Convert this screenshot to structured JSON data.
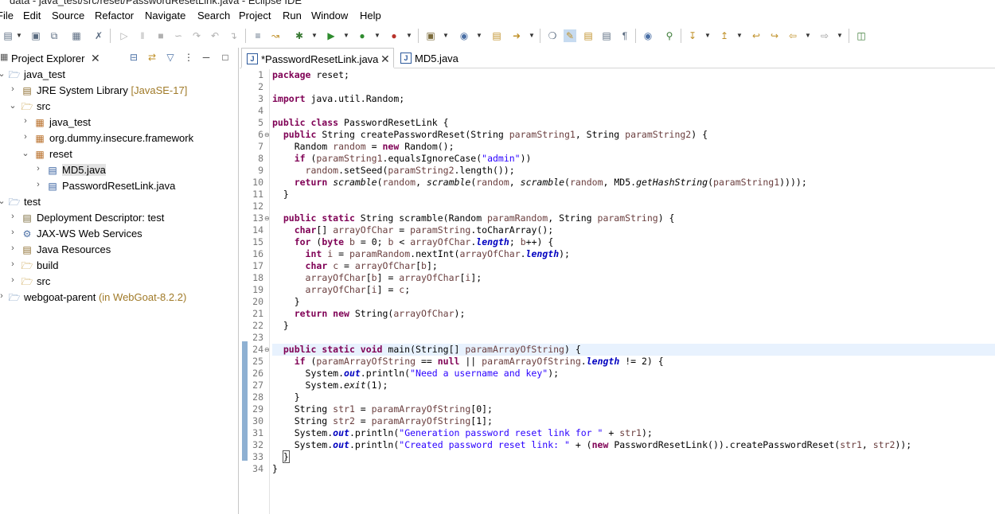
{
  "window": {
    "title": "data - java_test/src/reset/PasswordResetLink.java - Eclipse IDE"
  },
  "menu": [
    "File",
    "Edit",
    "Source",
    "Refactor",
    "Navigate",
    "Search",
    "Project",
    "Run",
    "Window",
    "Help"
  ],
  "explorer": {
    "tab_label": "Project Explorer",
    "tree": [
      {
        "label": "java_test",
        "decoration": ""
      },
      {
        "label": "JRE System Library",
        "decoration": "[JavaSE-17]"
      },
      {
        "label": "src",
        "decoration": ""
      },
      {
        "label": "java_test",
        "decoration": ""
      },
      {
        "label": "org.dummy.insecure.framework",
        "decoration": ""
      },
      {
        "label": "reset",
        "decoration": ""
      },
      {
        "label": "MD5.java",
        "decoration": ""
      },
      {
        "label": "PasswordResetLink.java",
        "decoration": ""
      },
      {
        "label": "test",
        "decoration": ""
      },
      {
        "label": "Deployment Descriptor: test",
        "decoration": ""
      },
      {
        "label": "JAX-WS Web Services",
        "decoration": ""
      },
      {
        "label": "Java Resources",
        "decoration": ""
      },
      {
        "label": "build",
        "decoration": ""
      },
      {
        "label": "src",
        "decoration": ""
      },
      {
        "label": "webgoat-parent",
        "decoration": "(in WebGoat-8.2.2)"
      }
    ]
  },
  "editor": {
    "tabs": [
      {
        "label": "*PasswordResetLink.java",
        "active": true
      },
      {
        "label": "MD5.java",
        "active": false
      }
    ],
    "line_numbers": [
      "1",
      "2",
      "3",
      "4",
      "5",
      "6",
      "7",
      "8",
      "9",
      "10",
      "11",
      "12",
      "13",
      "14",
      "15",
      "16",
      "17",
      "18",
      "19",
      "20",
      "21",
      "22",
      "23",
      "24",
      "25",
      "26",
      "27",
      "28",
      "29",
      "30",
      "31",
      "32",
      "33",
      "34"
    ],
    "lines": [
      [
        [
          "k",
          "package"
        ],
        [
          "p",
          " reset;"
        ]
      ],
      [],
      [
        [
          "k",
          "import"
        ],
        [
          "p",
          " java.util.Random;"
        ]
      ],
      [],
      [
        [
          "k",
          "public class"
        ],
        [
          "p",
          " PasswordResetLink {"
        ]
      ],
      [
        [
          "p",
          "  "
        ],
        [
          "k",
          "public"
        ],
        [
          "p",
          " String createPasswordReset(String "
        ],
        [
          "v",
          "paramString1"
        ],
        [
          "p",
          ", String "
        ],
        [
          "v",
          "paramString2"
        ],
        [
          "p",
          ") {"
        ]
      ],
      [
        [
          "p",
          "    Random "
        ],
        [
          "v",
          "random"
        ],
        [
          "p",
          " = "
        ],
        [
          "k",
          "new"
        ],
        [
          "p",
          " Random();"
        ]
      ],
      [
        [
          "p",
          "    "
        ],
        [
          "k",
          "if"
        ],
        [
          "p",
          " ("
        ],
        [
          "v",
          "paramString1"
        ],
        [
          "p",
          ".equalsIgnoreCase("
        ],
        [
          "s",
          "\"admin\""
        ],
        [
          "p",
          "))"
        ]
      ],
      [
        [
          "p",
          "      "
        ],
        [
          "v",
          "random"
        ],
        [
          "p",
          ".setSeed("
        ],
        [
          "v",
          "paramString2"
        ],
        [
          "p",
          ".length());"
        ]
      ],
      [
        [
          "p",
          "    "
        ],
        [
          "k",
          "return"
        ],
        [
          "p",
          " "
        ],
        [
          "i",
          "scramble"
        ],
        [
          "p",
          "("
        ],
        [
          "v",
          "random"
        ],
        [
          "p",
          ", "
        ],
        [
          "i",
          "scramble"
        ],
        [
          "p",
          "("
        ],
        [
          "v",
          "random"
        ],
        [
          "p",
          ", "
        ],
        [
          "i",
          "scramble"
        ],
        [
          "p",
          "("
        ],
        [
          "v",
          "random"
        ],
        [
          "p",
          ", MD5."
        ],
        [
          "i",
          "getHashString"
        ],
        [
          "p",
          "("
        ],
        [
          "v",
          "paramString1"
        ],
        [
          "p",
          "))));"
        ]
      ],
      [
        [
          "p",
          "  }"
        ]
      ],
      [],
      [
        [
          "p",
          "  "
        ],
        [
          "k",
          "public static"
        ],
        [
          "p",
          " String scramble(Random "
        ],
        [
          "v",
          "paramRandom"
        ],
        [
          "p",
          ", String "
        ],
        [
          "v",
          "paramString"
        ],
        [
          "p",
          ") {"
        ]
      ],
      [
        [
          "p",
          "    "
        ],
        [
          "k",
          "char"
        ],
        [
          "p",
          "[] "
        ],
        [
          "v",
          "arrayOfChar"
        ],
        [
          "p",
          " = "
        ],
        [
          "v",
          "paramString"
        ],
        [
          "p",
          ".toCharArray();"
        ]
      ],
      [
        [
          "p",
          "    "
        ],
        [
          "k",
          "for"
        ],
        [
          "p",
          " ("
        ],
        [
          "k",
          "byte"
        ],
        [
          "p",
          " "
        ],
        [
          "v",
          "b"
        ],
        [
          "p",
          " = 0; "
        ],
        [
          "v",
          "b"
        ],
        [
          "p",
          " < "
        ],
        [
          "v",
          "arrayOfChar"
        ],
        [
          "p",
          "."
        ],
        [
          "f",
          "length"
        ],
        [
          "p",
          "; "
        ],
        [
          "v",
          "b"
        ],
        [
          "p",
          "++) {"
        ]
      ],
      [
        [
          "p",
          "      "
        ],
        [
          "k",
          "int"
        ],
        [
          "p",
          " "
        ],
        [
          "v",
          "i"
        ],
        [
          "p",
          " = "
        ],
        [
          "v",
          "paramRandom"
        ],
        [
          "p",
          ".nextInt("
        ],
        [
          "v",
          "arrayOfChar"
        ],
        [
          "p",
          "."
        ],
        [
          "f",
          "length"
        ],
        [
          "p",
          ");"
        ]
      ],
      [
        [
          "p",
          "      "
        ],
        [
          "k",
          "char"
        ],
        [
          "p",
          " "
        ],
        [
          "v",
          "c"
        ],
        [
          "p",
          " = "
        ],
        [
          "v",
          "arrayOfChar"
        ],
        [
          "p",
          "["
        ],
        [
          "v",
          "b"
        ],
        [
          "p",
          "];"
        ]
      ],
      [
        [
          "p",
          "      "
        ],
        [
          "v",
          "arrayOfChar"
        ],
        [
          "p",
          "["
        ],
        [
          "v",
          "b"
        ],
        [
          "p",
          "] = "
        ],
        [
          "v",
          "arrayOfChar"
        ],
        [
          "p",
          "["
        ],
        [
          "v",
          "i"
        ],
        [
          "p",
          "];"
        ]
      ],
      [
        [
          "p",
          "      "
        ],
        [
          "v",
          "arrayOfChar"
        ],
        [
          "p",
          "["
        ],
        [
          "v",
          "i"
        ],
        [
          "p",
          "] = "
        ],
        [
          "v",
          "c"
        ],
        [
          "p",
          ";"
        ]
      ],
      [
        [
          "p",
          "    }"
        ]
      ],
      [
        [
          "p",
          "    "
        ],
        [
          "k",
          "return new"
        ],
        [
          "p",
          " String("
        ],
        [
          "v",
          "arrayOfChar"
        ],
        [
          "p",
          ");"
        ]
      ],
      [
        [
          "p",
          "  }"
        ]
      ],
      [],
      [
        [
          "p",
          "  "
        ],
        [
          "k",
          "public static void"
        ],
        [
          "p",
          " main(String[] "
        ],
        [
          "v",
          "paramArrayOfString"
        ],
        [
          "p",
          ") {"
        ]
      ],
      [
        [
          "p",
          "    "
        ],
        [
          "k",
          "if"
        ],
        [
          "p",
          " ("
        ],
        [
          "v",
          "paramArrayOfString"
        ],
        [
          "p",
          " == "
        ],
        [
          "k",
          "null"
        ],
        [
          "p",
          " || "
        ],
        [
          "v",
          "paramArrayOfString"
        ],
        [
          "p",
          "."
        ],
        [
          "f",
          "length"
        ],
        [
          "p",
          " != 2) {"
        ]
      ],
      [
        [
          "p",
          "      System."
        ],
        [
          "o",
          "out"
        ],
        [
          "p",
          ".println("
        ],
        [
          "s",
          "\"Need a username and key\""
        ],
        [
          "p",
          ");"
        ]
      ],
      [
        [
          "p",
          "      System."
        ],
        [
          "i",
          "exit"
        ],
        [
          "p",
          "(1);"
        ]
      ],
      [
        [
          "p",
          "    }"
        ]
      ],
      [
        [
          "p",
          "    String "
        ],
        [
          "v",
          "str1"
        ],
        [
          "p",
          " = "
        ],
        [
          "v",
          "paramArrayOfString"
        ],
        [
          "p",
          "[0];"
        ]
      ],
      [
        [
          "p",
          "    String "
        ],
        [
          "v",
          "str2"
        ],
        [
          "p",
          " = "
        ],
        [
          "v",
          "paramArrayOfString"
        ],
        [
          "p",
          "[1];"
        ]
      ],
      [
        [
          "p",
          "    System."
        ],
        [
          "o",
          "out"
        ],
        [
          "p",
          ".println("
        ],
        [
          "s",
          "\"Generation password reset link for \""
        ],
        [
          "p",
          " + "
        ],
        [
          "v",
          "str1"
        ],
        [
          "p",
          ");"
        ]
      ],
      [
        [
          "p",
          "    System."
        ],
        [
          "o",
          "out"
        ],
        [
          "p",
          ".println("
        ],
        [
          "s",
          "\"Created password reset link: \""
        ],
        [
          "p",
          " + ("
        ],
        [
          "k",
          "new"
        ],
        [
          "p",
          " PasswordResetLink()).createPasswordReset("
        ],
        [
          "v",
          "str1"
        ],
        [
          "p",
          ", "
        ],
        [
          "v",
          "str2"
        ],
        [
          "p",
          "));"
        ]
      ],
      [
        [
          "p",
          "  "
        ],
        [
          "c",
          "}"
        ]
      ],
      [
        [
          "p",
          "}"
        ]
      ]
    ]
  }
}
